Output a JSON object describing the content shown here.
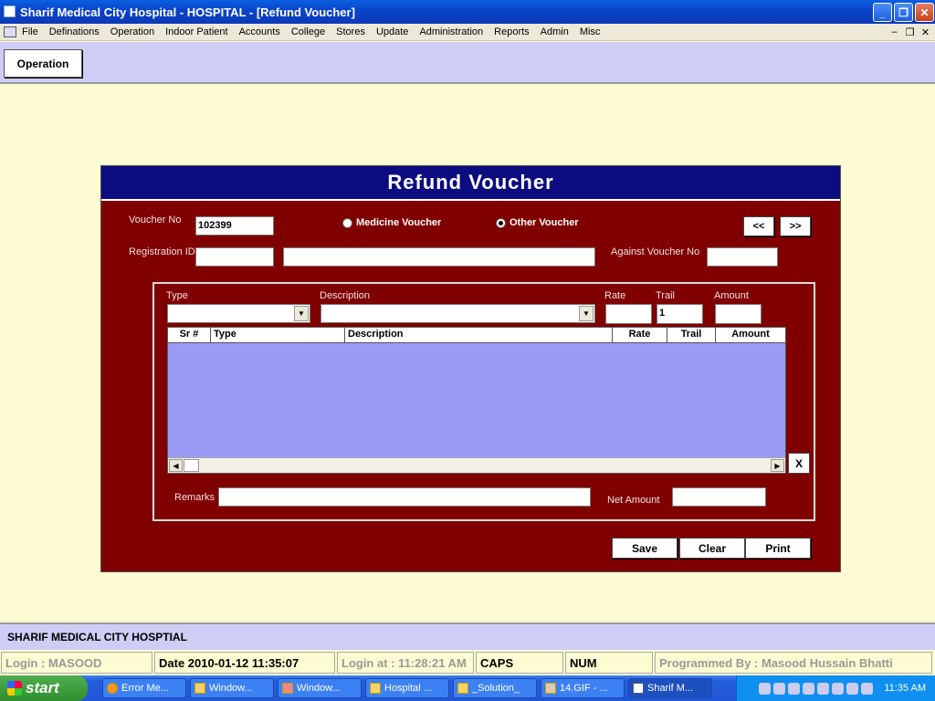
{
  "window": {
    "title": "Sharif Medical City Hospital - HOSPITAL - [Refund Voucher]"
  },
  "menu": [
    "File",
    "Definations",
    "Operation",
    "Indoor Patient",
    "Accounts",
    "College",
    "Stores",
    "Update",
    "Administration",
    "Reports",
    "Admin",
    "Misc"
  ],
  "toolbar": {
    "operation_label": "Operation"
  },
  "form": {
    "title": "Refund Voucher",
    "voucher_no_label": "Voucher No",
    "voucher_no_value": "102399",
    "medicine_voucher_label": "Medicine Voucher",
    "other_voucher_label": "Other Voucher",
    "selected_voucher_type": "Other Voucher",
    "prev_label": "<<",
    "next_label": ">>",
    "registration_id_label": "Registration ID",
    "registration_id_value": "",
    "patient_name_value": "",
    "against_voucher_label": "Against Voucher No",
    "against_voucher_value": "",
    "type_label": "Type",
    "description_label": "Description",
    "rate_label": "Rate",
    "trail_label": "Trail",
    "amount_label": "Amount",
    "type_value": "",
    "description_value": "",
    "rate_value": "",
    "trail_value": "1",
    "amount_value": "",
    "grid_columns": [
      "Sr #",
      "Type",
      "Description",
      "Rate",
      "Trail",
      "Amount"
    ],
    "grid_rows": [],
    "delete_label": "X",
    "remarks_label": "Remarks",
    "remarks_value": "",
    "net_amount_label": "Net Amount",
    "net_amount_value": "",
    "save_label": "Save",
    "clear_label": "Clear",
    "print_label": "Print"
  },
  "footer": {
    "hospital_name": "SHARIF MEDICAL CITY HOSPTIAL"
  },
  "status": {
    "login": "Login :  MASOOD",
    "date": "Date 2010-01-12 11:35:07",
    "login_at": "Login at : 11:28:21 AM",
    "caps": "CAPS",
    "num": "NUM",
    "programmed_by": "Programmed By : Masood Hussain Bhatti"
  },
  "taskbar": {
    "start_label": "start",
    "tasks": [
      "Error Me...",
      "Window...",
      "Window...",
      "Hospital ...",
      "_Solution_",
      "14.GIF - ...",
      "Sharif M..."
    ],
    "clock": "11:35 AM"
  },
  "colors": {
    "panel": "#800000",
    "header": "#0c0c80",
    "grid": "#9a9af5",
    "background": "#fdfbd2",
    "band": "#cdcdf5"
  }
}
